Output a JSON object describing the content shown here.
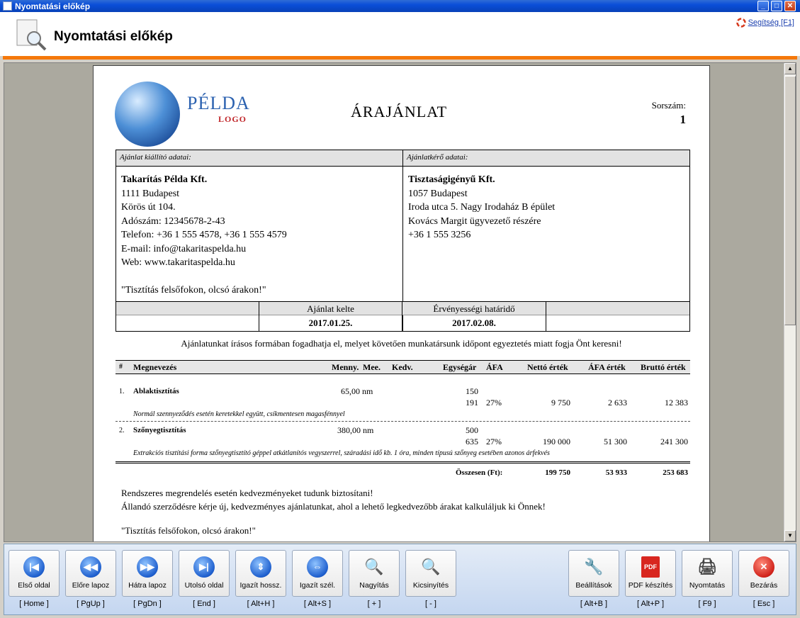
{
  "window": {
    "title": "Nyomtatási előkép"
  },
  "header": {
    "title": "Nyomtatási előkép",
    "help": "Segítség [F1]"
  },
  "doc": {
    "logo_word": "PÉLDA",
    "logo_sub": "LOGO",
    "title": "ÁRAJÁNLAT",
    "serial_label": "Sorszám:",
    "serial_value": "1",
    "issuer_head": "Ajánlat kiállító adatai:",
    "requester_head": "Ajánlatkérő adatai:",
    "issuer": {
      "name": "Takarítás Példa Kft.",
      "lines": [
        "1111 Budapest",
        "Körös út 104.",
        "Adószám: 12345678-2-43",
        "Telefon: +36 1 555 4578, +36 1 555 4579",
        "E-mail: info@takaritaspelda.hu",
        "Web: www.takaritaspelda.hu",
        "",
        "\"Tisztítás felsőfokon, olcsó árakon!\""
      ]
    },
    "requester": {
      "name": "Tisztaságigényű Kft.",
      "lines": [
        "1057 Budapest",
        "Iroda utca 5. Nagy Irodaház B épület",
        "Kovács Margit ügyvezető részére",
        "+36 1 555 3256"
      ]
    },
    "date_label": "Ajánlat kelte",
    "date_value": "2017.01.25.",
    "valid_label": "Érvényességi határidő",
    "valid_value": "2017.02.08.",
    "note": "Ajánlatunkat írásos formában fogadhatja el, melyet követően munkatársunk időpont egyeztetés miatt fogja Önt keresni!",
    "cols": {
      "num": "#",
      "name": "Megnevezés",
      "qty": "Menny.",
      "unit": "Mee.",
      "disc": "Kedv.",
      "price": "Egységár",
      "vat": "ÁFA",
      "net": "Nettó érték",
      "vatval": "ÁFA érték",
      "gross": "Bruttó érték"
    },
    "items": [
      {
        "num": "1.",
        "name": "Ablaktisztítás",
        "qty": "65,00 nm",
        "price1": "150",
        "price2": "191",
        "vat": "27%",
        "net": "9 750",
        "vatval": "2 633",
        "gross": "12 383",
        "desc": "Normál szennyeződés esetén keretekkel együtt, csíkmentesen magasfénnyel"
      },
      {
        "num": "2.",
        "name": "Szőnyegtisztítás",
        "qty": "380,00 nm",
        "price1": "500",
        "price2": "635",
        "vat": "27%",
        "net": "190 000",
        "vatval": "51 300",
        "gross": "241 300",
        "desc": "Extrakciós tisztítási forma szőnyegtisztító géppel atkátlanítós vegyszerrel, száradási idő kb. 1 óra, minden típusú szőnyeg esetében azonos árfekvés"
      }
    ],
    "total_label": "Összesen (Ft):",
    "total_net": "199 750",
    "total_vat": "53 933",
    "total_gross": "253 683",
    "footer1": "Rendszeres megrendelés esetén kedvezményeket tudunk biztosítani!",
    "footer2": "Állandó szerződésre kérje új, kedvezményes ajánlatunkat, ahol a lehető legkedvezőbb árakat kalkuláljuk ki Önnek!",
    "footer3": "\"Tisztítás felsőfokon, olcsó árakon!\""
  },
  "toolbar": {
    "first": {
      "label": "Első oldal",
      "shortcut": "[ Home ]"
    },
    "prev": {
      "label": "Előre lapoz",
      "shortcut": "[ PgUp ]"
    },
    "next": {
      "label": "Hátra lapoz",
      "shortcut": "[ PgDn ]"
    },
    "last": {
      "label": "Utolsó oldal",
      "shortcut": "[ End ]"
    },
    "fith": {
      "label": "Igazít hossz.",
      "shortcut": "[ Alt+H ]"
    },
    "fitw": {
      "label": "Igazít szél.",
      "shortcut": "[ Alt+S ]"
    },
    "zoomin": {
      "label": "Nagyítás",
      "shortcut": "[ + ]"
    },
    "zoomout": {
      "label": "Kicsinyítés",
      "shortcut": "[ - ]"
    },
    "settings": {
      "label": "Beállítások",
      "shortcut": "[ Alt+B ]"
    },
    "pdf": {
      "label": "PDF készítés",
      "shortcut": "[ Alt+P ]"
    },
    "print": {
      "label": "Nyomtatás",
      "shortcut": "[ F9 ]"
    },
    "close": {
      "label": "Bezárás",
      "shortcut": "[ Esc ]"
    }
  }
}
